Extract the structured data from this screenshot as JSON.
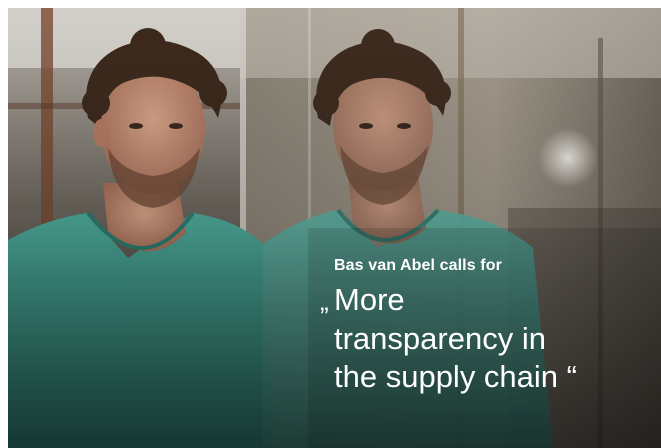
{
  "hero": {
    "image_alt_icon": "portrait-photo",
    "kicker": "Bas van Abel calls for",
    "headline": {
      "open_quote": "„",
      "line1": "More",
      "line2": "transparency in",
      "line3": "the supply chain “"
    }
  },
  "colors": {
    "shirt": "#4aa596",
    "text": "#ffffff",
    "background_warm": "#7a6a55"
  }
}
